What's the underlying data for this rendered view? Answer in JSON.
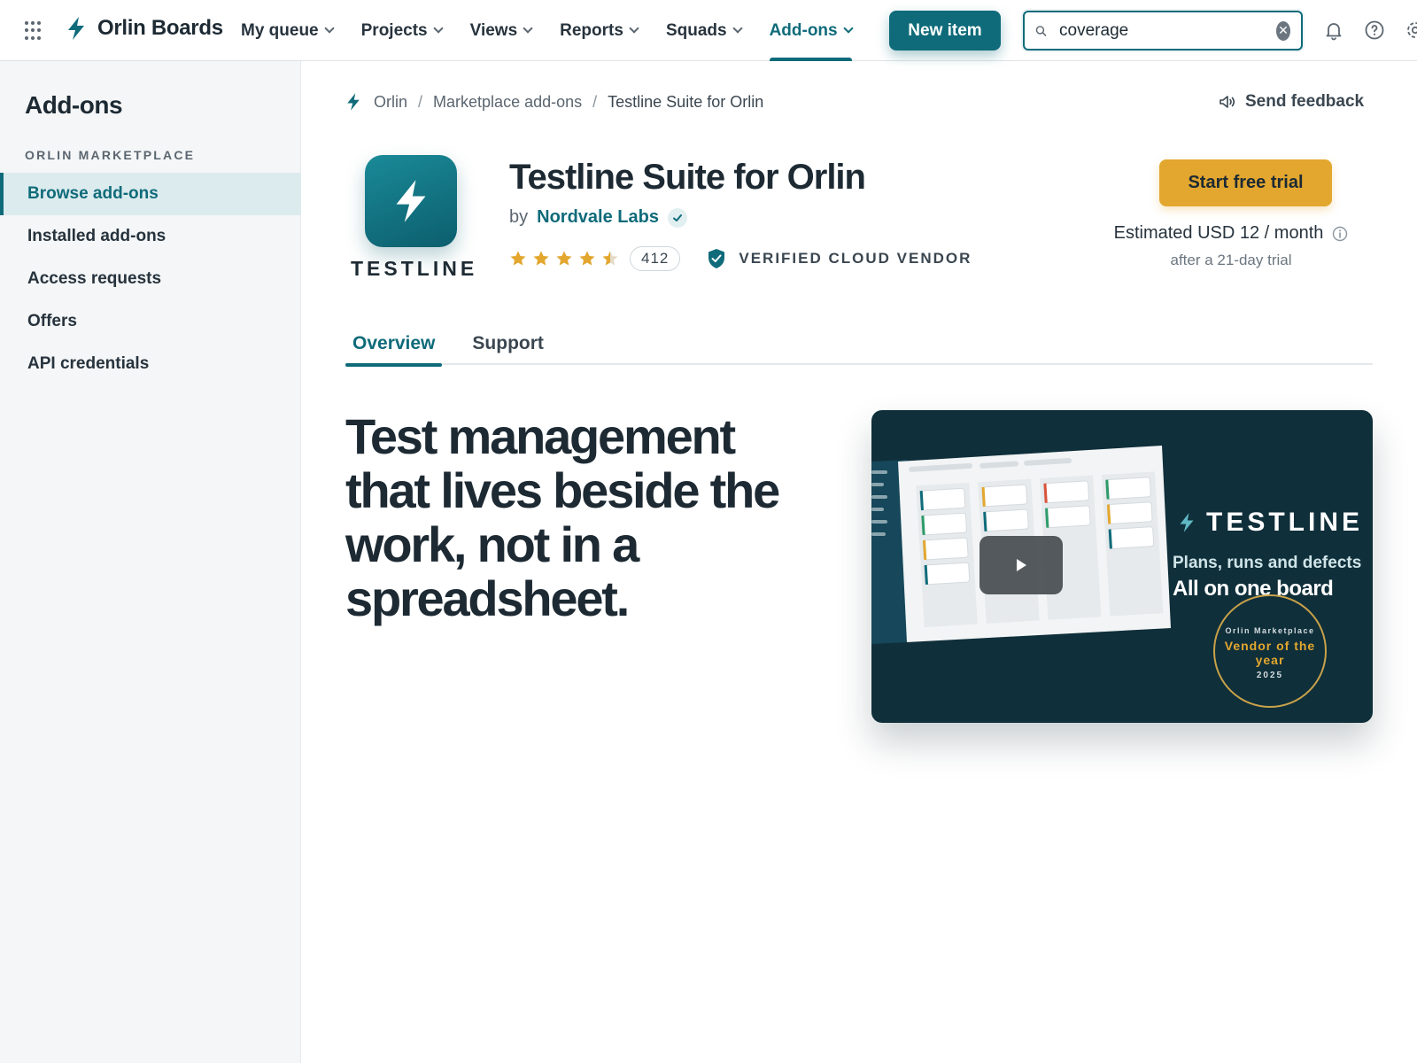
{
  "app": {
    "name": "Orlin Boards"
  },
  "nav": {
    "items": [
      {
        "label": "My queue"
      },
      {
        "label": "Projects"
      },
      {
        "label": "Views"
      },
      {
        "label": "Reports"
      },
      {
        "label": "Squads"
      },
      {
        "label": "Add-ons",
        "active": true
      }
    ],
    "new_button": "New item",
    "search_value": "coverage"
  },
  "sidebar": {
    "title": "Add-ons",
    "section": "ORLIN MARKETPLACE",
    "items": [
      {
        "label": "Browse add-ons",
        "active": true
      },
      {
        "label": "Installed add-ons"
      },
      {
        "label": "Access requests"
      },
      {
        "label": "Offers"
      },
      {
        "label": "API credentials"
      }
    ]
  },
  "breadcrumb": [
    "Orlin",
    "Marketplace add-ons",
    "Testline Suite for Orlin"
  ],
  "feedback_label": "Send feedback",
  "product": {
    "logo_word": "TESTLINE",
    "title": "Testline Suite for Orlin",
    "by": "by",
    "vendor": "Nordvale Labs",
    "rating": 4.5,
    "review_count": "412",
    "verified_label": "VERIFIED CLOUD VENDOR",
    "cta": "Start free trial",
    "price": "Estimated USD 12 / month",
    "price_note": "after a 21-day trial"
  },
  "tabs": [
    {
      "label": "Overview",
      "active": true
    },
    {
      "label": "Support"
    }
  ],
  "hero": "Test management that lives beside the work, not in a spreadsheet.",
  "media": {
    "brand": "TESTLINE",
    "line1": "Plans, runs and defects",
    "line2": "All on one board",
    "award_top": "Orlin Marketplace",
    "award_mid": "Vendor of the year",
    "award_year": "2025"
  },
  "colors": {
    "accent": "#0f6b7a",
    "cta": "#e3a72f",
    "star": "#e3a72f",
    "media_bg": "#0f2f3a"
  },
  "icons": [
    "apps-grid-icon",
    "bolt-icon",
    "search-icon",
    "clear-icon",
    "bell-icon",
    "help-icon",
    "gear-icon",
    "megaphone-icon",
    "verified-check-icon",
    "shield-check-icon",
    "info-icon",
    "play-icon",
    "star-icon"
  ]
}
